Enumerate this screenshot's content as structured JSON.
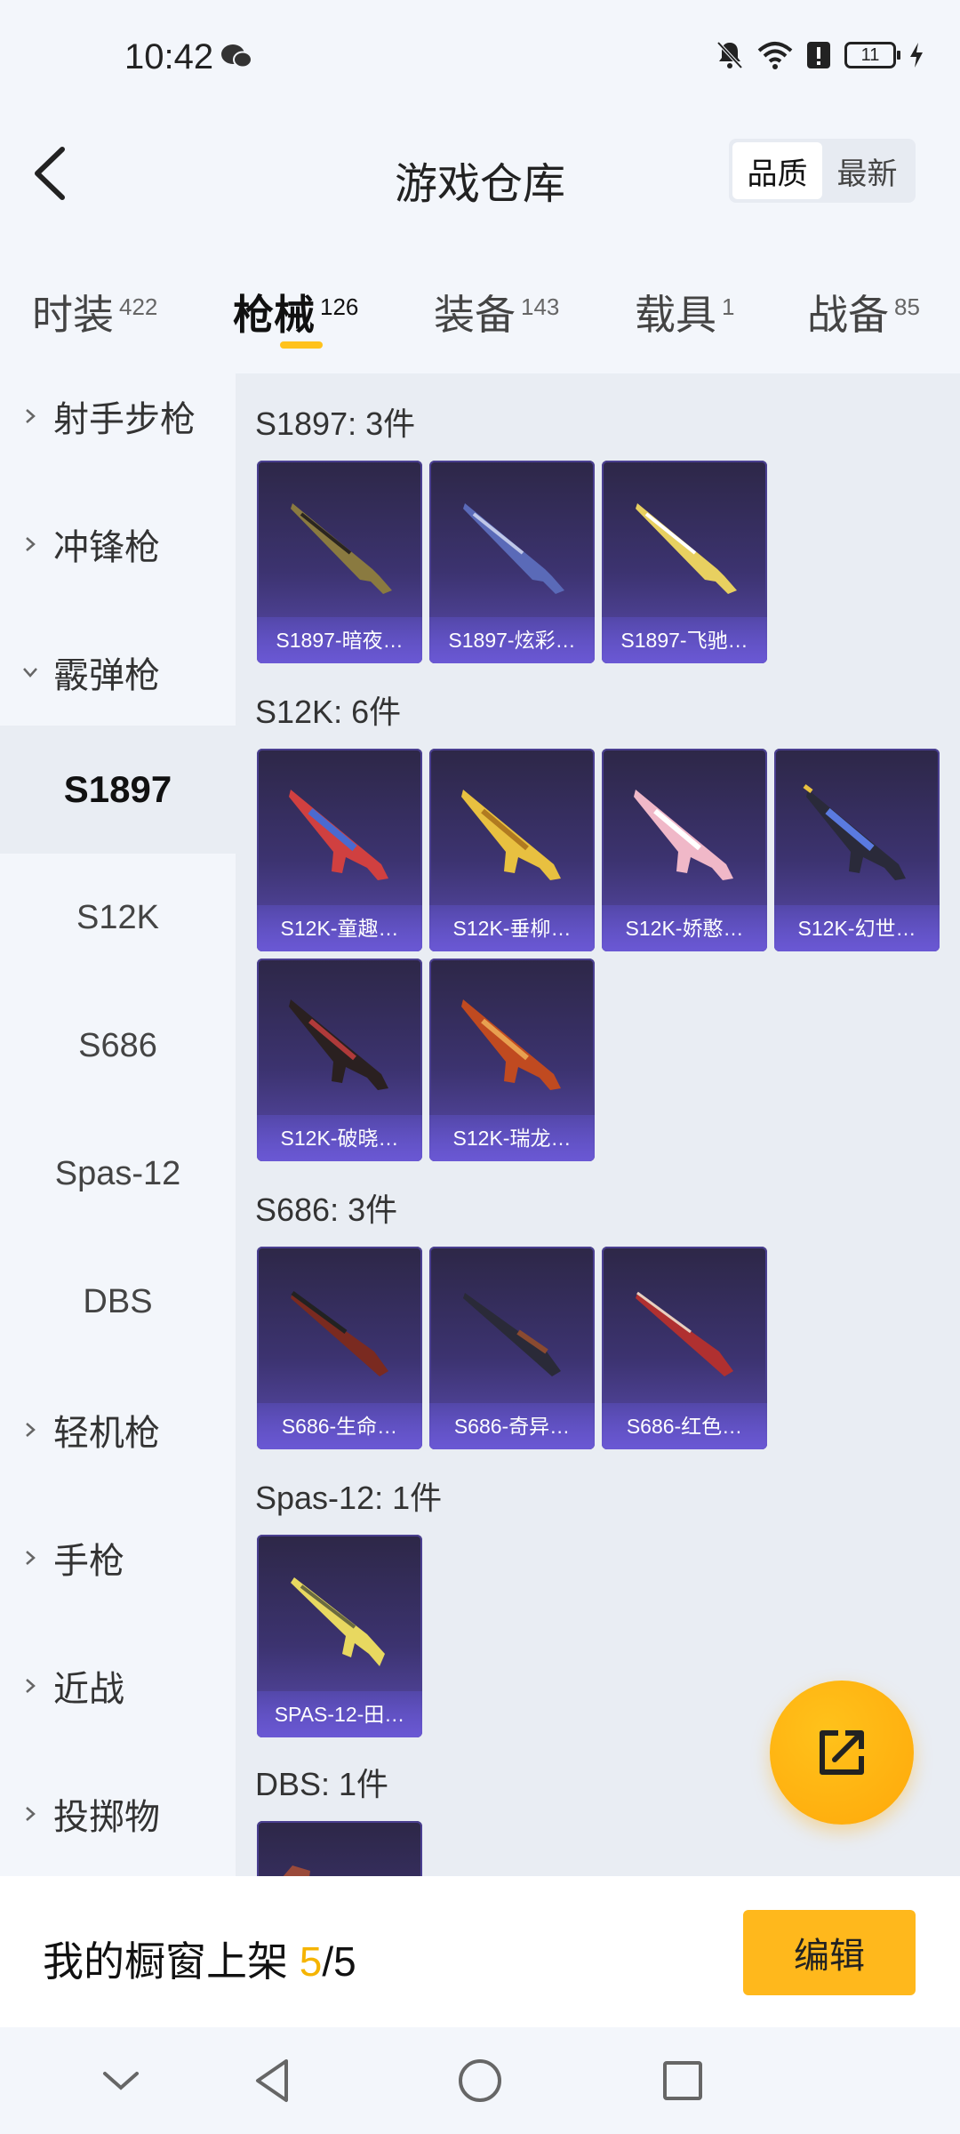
{
  "status": {
    "time": "10:42",
    "battery": "11"
  },
  "header": {
    "title": "游戏仓库",
    "sort_options": [
      "品质",
      "最新"
    ]
  },
  "tabs": [
    {
      "label": "时装",
      "count": "422"
    },
    {
      "label": "枪械",
      "count": "126"
    },
    {
      "label": "装备",
      "count": "143"
    },
    {
      "label": "载具",
      "count": "1"
    },
    {
      "label": "战备",
      "count": "85"
    }
  ],
  "sidebar": {
    "items": [
      {
        "label": "射手步枪"
      },
      {
        "label": "冲锋枪"
      },
      {
        "label": "霰弹枪"
      },
      {
        "label": "S1897"
      },
      {
        "label": "S12K"
      },
      {
        "label": "S686"
      },
      {
        "label": "Spas-12"
      },
      {
        "label": "DBS"
      },
      {
        "label": "轻机枪"
      },
      {
        "label": "手枪"
      },
      {
        "label": "近战"
      },
      {
        "label": "投掷物"
      }
    ]
  },
  "groups": [
    {
      "title": "S1897: 3件",
      "items": [
        "S1897-暗夜…",
        "S1897-炫彩…",
        "S1897-飞驰…"
      ]
    },
    {
      "title": "S12K: 6件",
      "items": [
        "S12K-童趣…",
        "S12K-垂柳…",
        "S12K-娇憨…",
        "S12K-幻世…",
        "S12K-破晓…",
        "S12K-瑞龙…"
      ]
    },
    {
      "title": "S686: 3件",
      "items": [
        "S686-生命…",
        "S686-奇异…",
        "S686-红色…"
      ]
    },
    {
      "title": "Spas-12: 1件",
      "items": [
        "SPAS-12-田…"
      ]
    },
    {
      "title": "DBS: 1件",
      "items": []
    }
  ],
  "bottom": {
    "showcase_label": "我的橱窗上架",
    "showcase_current": "5",
    "showcase_total": "/5",
    "edit_label": "编辑"
  },
  "colors": {
    "accent": "#ffb81c",
    "card_bg": "#3c3370",
    "card_caption": "#6a58d4"
  },
  "icons": [
    "wechat-icon",
    "mute-icon",
    "wifi-icon",
    "alert-icon",
    "battery-icon",
    "charging-icon",
    "back-icon",
    "chevron-right-icon",
    "chevron-down-icon",
    "share-edit-icon",
    "nav-down-icon",
    "nav-back-icon",
    "nav-home-icon",
    "nav-recent-icon"
  ]
}
